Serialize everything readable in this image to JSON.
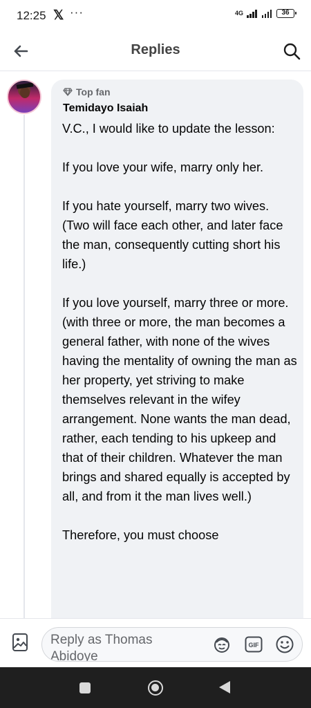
{
  "status_bar": {
    "time": "12:25",
    "x_app": "𝕏",
    "more": "···",
    "network": "4G",
    "battery": "36"
  },
  "header": {
    "title": "Replies",
    "back_icon": "arrow-left-icon",
    "search_icon": "search-icon"
  },
  "comment": {
    "badge_icon": "diamond-icon",
    "badge": "Top fan",
    "author": "Temidayo Isaiah",
    "paragraphs": [
      "V.C., I would like to  update the lesson:",
      "If you love your wife, marry only her.",
      "If you hate yourself, marry two wives. (Two will face each other, and later face the man, consequently cutting short his life.)",
      "If you love yourself, marry three or more. (with three or more, the man becomes a general father, with none of the wives having the mentality of owning the man as her property, yet striving to make themselves relevant in the wifey arrangement. None wants the man dead, rather, each tending to his upkeep and that of their children. Whatever the man brings and shared equally is accepted by all, and from it the man lives well.)",
      "Therefore, you must choose"
    ]
  },
  "composer": {
    "placeholder": "Reply as Thomas Abidoye",
    "icons": [
      "photo-icon",
      "avatar-sticker-icon",
      "gif-icon",
      "emoji-icon"
    ],
    "gif_label": "GIF"
  },
  "colors": {
    "bubble": "#f0f2f5",
    "icon": "#444950",
    "nav_bar": "#1f1f1f"
  }
}
